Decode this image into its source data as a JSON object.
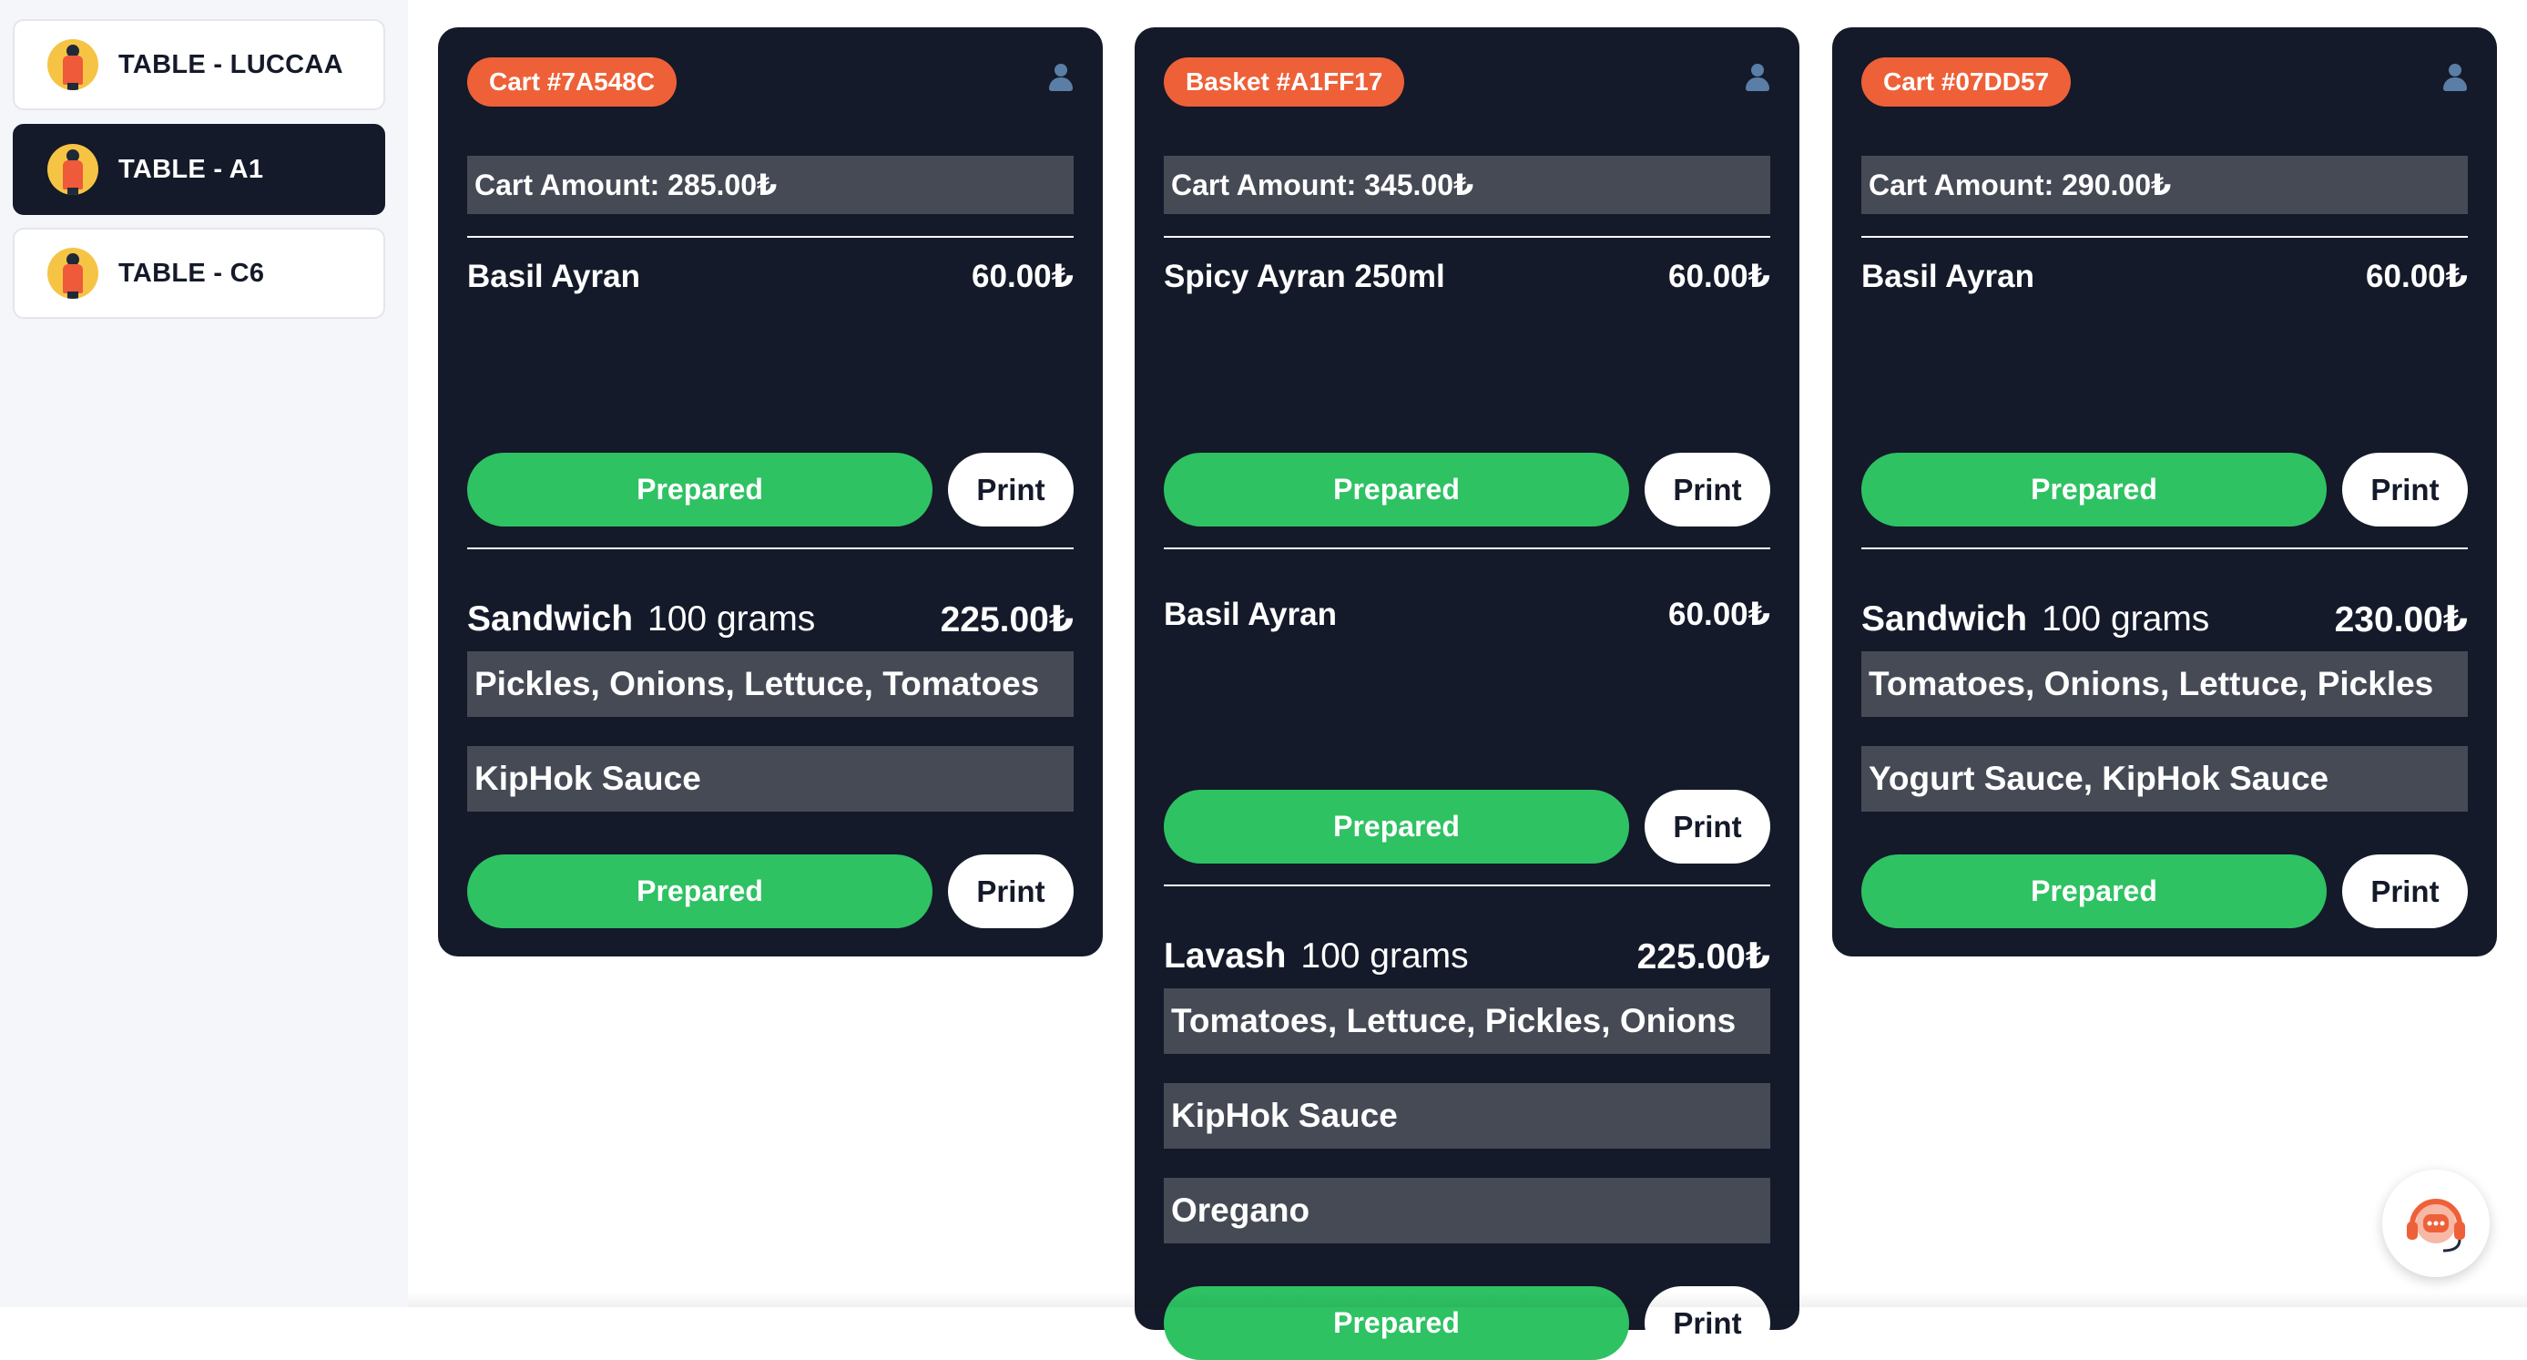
{
  "sidebar": {
    "tables": [
      {
        "label": "TABLE - LUCCAA",
        "active": false
      },
      {
        "label": "TABLE - A1",
        "active": true
      },
      {
        "label": "TABLE - C6",
        "active": false
      }
    ]
  },
  "orders": [
    {
      "badge": "Cart #7A548C",
      "amount": "Cart Amount: 285.00₺",
      "items": [
        {
          "name": "Basil Ayran",
          "price": "60.00₺",
          "options": [],
          "prepared_label": "Prepared",
          "print_label": "Print"
        },
        {
          "name": "Sandwich",
          "size": "100 grams",
          "price": "225.00₺",
          "options": [
            "Pickles, Onions, Lettuce, Tomatoes",
            "KipHok Sauce"
          ],
          "prepared_label": "Prepared",
          "print_label": "Print"
        }
      ]
    },
    {
      "badge": "Basket #A1FF17",
      "amount": "Cart Amount: 345.00₺",
      "items": [
        {
          "name": "Spicy Ayran 250ml",
          "price": "60.00₺",
          "options": [],
          "prepared_label": "Prepared",
          "print_label": "Print"
        },
        {
          "name": "Basil Ayran",
          "price": "60.00₺",
          "options": [],
          "prepared_label": "Prepared",
          "print_label": "Print"
        },
        {
          "name": "Lavash",
          "size": "100 grams",
          "price": "225.00₺",
          "options": [
            "Tomatoes, Lettuce, Pickles, Onions",
            "KipHok Sauce",
            "Oregano"
          ],
          "prepared_label": "Prepared",
          "print_label": "Print"
        }
      ]
    },
    {
      "badge": "Cart #07DD57",
      "amount": "Cart Amount: 290.00₺",
      "items": [
        {
          "name": "Basil Ayran",
          "price": "60.00₺",
          "options": [],
          "prepared_label": "Prepared",
          "print_label": "Print"
        },
        {
          "name": "Sandwich",
          "size": "100 grams",
          "price": "230.00₺",
          "options": [
            "Tomatoes, Onions, Lettuce, Pickles",
            "Yogurt Sauce, KipHok Sauce"
          ],
          "prepared_label": "Prepared",
          "print_label": "Print"
        }
      ]
    }
  ],
  "colors": {
    "card_bg": "#141a29",
    "badge_bg": "#ee6038",
    "prepared_bg": "#2ec263",
    "option_bg": "#454a55",
    "sidebar_bg": "#f4f6f9",
    "support_accent": "#ee6038"
  },
  "icons": {
    "table_avatar": "waiter-avatar-icon",
    "card_user": "user-icon",
    "support": "support-headset-icon"
  }
}
